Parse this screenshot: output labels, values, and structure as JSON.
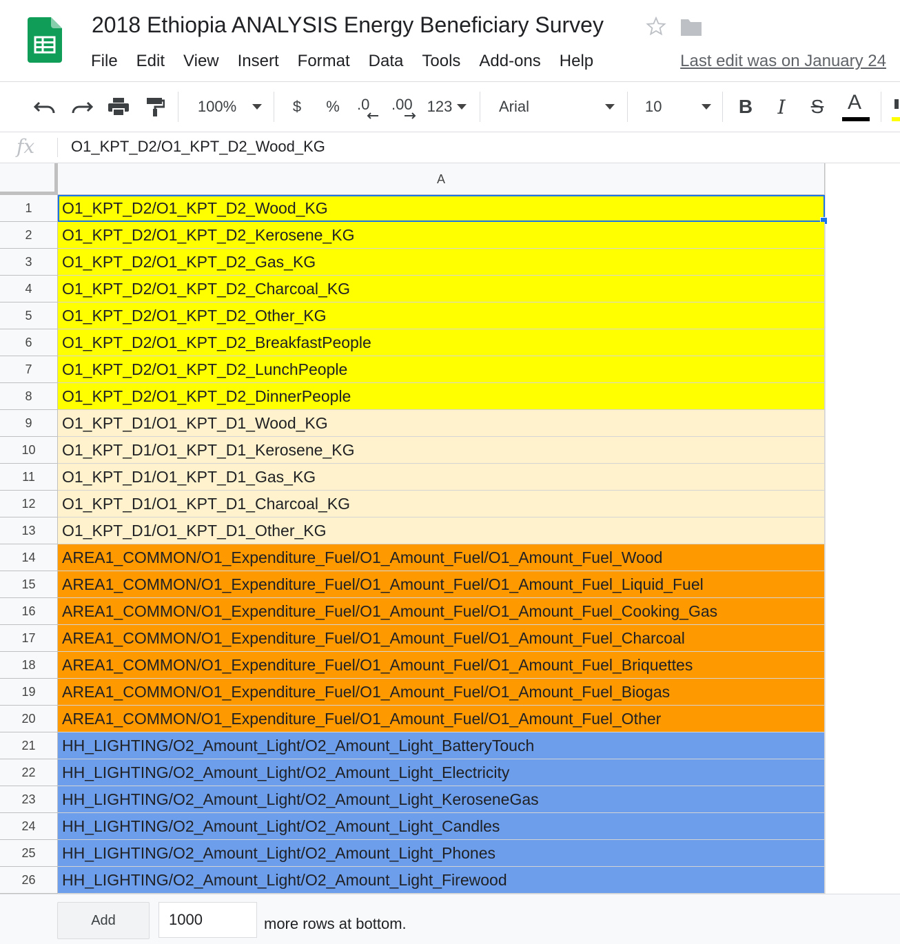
{
  "document": {
    "title": "2018 Ethiopia ANALYSIS Energy Beneficiary Survey",
    "last_edit": "Last edit was on January 24"
  },
  "menu": [
    "File",
    "Edit",
    "View",
    "Insert",
    "Format",
    "Data",
    "Tools",
    "Add-ons",
    "Help"
  ],
  "toolbar": {
    "zoom": "100%",
    "currency": "$",
    "percent": "%",
    "decrease_decimal": ".0",
    "increase_decimal": ".00",
    "more_formats": "123",
    "font": "Arial",
    "font_size": "10",
    "bold": "B",
    "italic": "I",
    "strikethrough": "S",
    "text_color": "A"
  },
  "formula_bar": {
    "label": "fx",
    "value": "O1_KPT_D2/O1_KPT_D2_Wood_KG"
  },
  "sheet": {
    "column_header": "A",
    "selected_cell": "A1",
    "rows": [
      {
        "num": "1",
        "value": "O1_KPT_D2/O1_KPT_D2_Wood_KG",
        "fill": "#ffff00"
      },
      {
        "num": "2",
        "value": "O1_KPT_D2/O1_KPT_D2_Kerosene_KG",
        "fill": "#ffff00"
      },
      {
        "num": "3",
        "value": "O1_KPT_D2/O1_KPT_D2_Gas_KG",
        "fill": "#ffff00"
      },
      {
        "num": "4",
        "value": "O1_KPT_D2/O1_KPT_D2_Charcoal_KG",
        "fill": "#ffff00"
      },
      {
        "num": "5",
        "value": "O1_KPT_D2/O1_KPT_D2_Other_KG",
        "fill": "#ffff00"
      },
      {
        "num": "6",
        "value": "O1_KPT_D2/O1_KPT_D2_BreakfastPeople",
        "fill": "#ffff00"
      },
      {
        "num": "7",
        "value": "O1_KPT_D2/O1_KPT_D2_LunchPeople",
        "fill": "#ffff00"
      },
      {
        "num": "8",
        "value": "O1_KPT_D2/O1_KPT_D2_DinnerPeople",
        "fill": "#ffff00"
      },
      {
        "num": "9",
        "value": "O1_KPT_D1/O1_KPT_D1_Wood_KG",
        "fill": "#fff2cc"
      },
      {
        "num": "10",
        "value": "O1_KPT_D1/O1_KPT_D1_Kerosene_KG",
        "fill": "#fff2cc"
      },
      {
        "num": "11",
        "value": "O1_KPT_D1/O1_KPT_D1_Gas_KG",
        "fill": "#fff2cc"
      },
      {
        "num": "12",
        "value": "O1_KPT_D1/O1_KPT_D1_Charcoal_KG",
        "fill": "#fff2cc"
      },
      {
        "num": "13",
        "value": "O1_KPT_D1/O1_KPT_D1_Other_KG",
        "fill": "#fff2cc"
      },
      {
        "num": "14",
        "value": "AREA1_COMMON/O1_Expenditure_Fuel/O1_Amount_Fuel/O1_Amount_Fuel_Wood",
        "fill": "#ff9900"
      },
      {
        "num": "15",
        "value": "AREA1_COMMON/O1_Expenditure_Fuel/O1_Amount_Fuel/O1_Amount_Fuel_Liquid_Fuel",
        "fill": "#ff9900"
      },
      {
        "num": "16",
        "value": "AREA1_COMMON/O1_Expenditure_Fuel/O1_Amount_Fuel/O1_Amount_Fuel_Cooking_Gas",
        "fill": "#ff9900"
      },
      {
        "num": "17",
        "value": "AREA1_COMMON/O1_Expenditure_Fuel/O1_Amount_Fuel/O1_Amount_Fuel_Charcoal",
        "fill": "#ff9900"
      },
      {
        "num": "18",
        "value": "AREA1_COMMON/O1_Expenditure_Fuel/O1_Amount_Fuel/O1_Amount_Fuel_Briquettes",
        "fill": "#ff9900"
      },
      {
        "num": "19",
        "value": "AREA1_COMMON/O1_Expenditure_Fuel/O1_Amount_Fuel/O1_Amount_Fuel_Biogas",
        "fill": "#ff9900"
      },
      {
        "num": "20",
        "value": "AREA1_COMMON/O1_Expenditure_Fuel/O1_Amount_Fuel/O1_Amount_Fuel_Other",
        "fill": "#ff9900"
      },
      {
        "num": "21",
        "value": "HH_LIGHTING/O2_Amount_Light/O2_Amount_Light_BatteryTouch",
        "fill": "#6d9eeb"
      },
      {
        "num": "22",
        "value": "HH_LIGHTING/O2_Amount_Light/O2_Amount_Light_Electricity",
        "fill": "#6d9eeb"
      },
      {
        "num": "23",
        "value": "HH_LIGHTING/O2_Amount_Light/O2_Amount_Light_KeroseneGas",
        "fill": "#6d9eeb"
      },
      {
        "num": "24",
        "value": "HH_LIGHTING/O2_Amount_Light/O2_Amount_Light_Candles",
        "fill": "#6d9eeb"
      },
      {
        "num": "25",
        "value": "HH_LIGHTING/O2_Amount_Light/O2_Amount_Light_Phones",
        "fill": "#6d9eeb"
      },
      {
        "num": "26",
        "value": "HH_LIGHTING/O2_Amount_Light/O2_Amount_Light_Firewood",
        "fill": "#6d9eeb"
      }
    ]
  },
  "footer": {
    "add_label": "Add",
    "rows_value": "1000",
    "suffix": "more rows at bottom."
  },
  "colors": {
    "sheets_green": "#0f9d58",
    "selection_blue": "#1a73e8",
    "text_color_bar": "#000000",
    "highlight_yellow": "#ffff00"
  },
  "icons": [
    "sheets-logo-icon",
    "star-icon",
    "folder-icon",
    "undo-icon",
    "redo-icon",
    "print-icon",
    "paint-format-icon",
    "chevron-down-icon",
    "bold-icon",
    "italic-icon",
    "strikethrough-icon",
    "text-color-icon",
    "highlight-icon"
  ]
}
